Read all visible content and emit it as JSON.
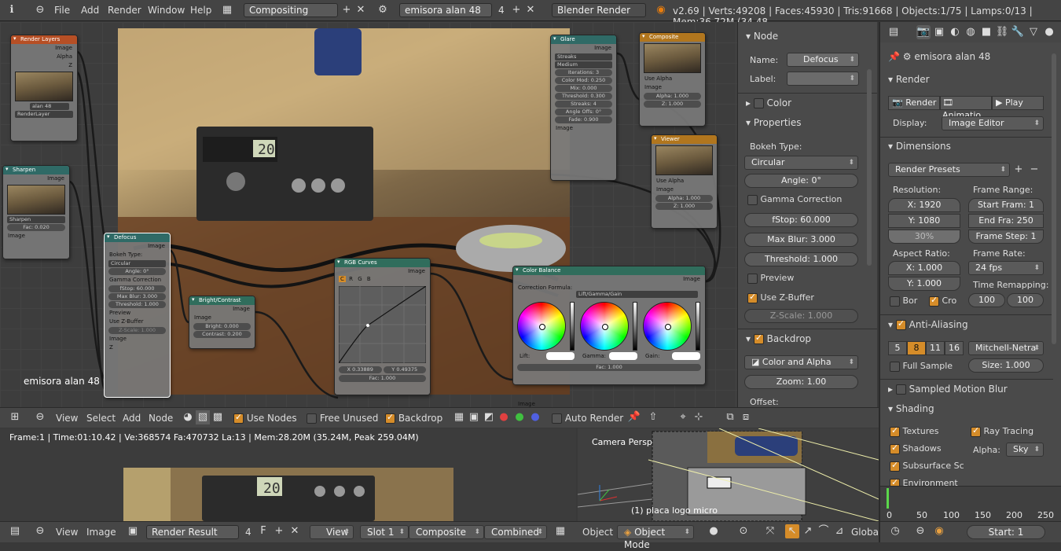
{
  "topbar": {
    "menus": [
      "File",
      "Add",
      "Render",
      "Window",
      "Help"
    ],
    "screen_layout": "Compositing",
    "scene": "emisora alan 48",
    "scene_users": "4",
    "engine": "Blender Render",
    "stats": "v2.69 | Verts:49208 | Faces:45930 | Tris:91668 | Objects:1/75 | Lamps:0/13 | Mem:36.72M (34.48"
  },
  "nodes": {
    "render_layers": {
      "title": "Render Layers",
      "out_image": "Image",
      "out_alpha": "Alpha",
      "out_z": "Z",
      "scene": "alan 48",
      "layer": "RenderLayer"
    },
    "sharpen": {
      "title": "Sharpen",
      "out_image": "Image",
      "mode": "Sharpen",
      "fac": "Fac: 0.020",
      "in_image": "Image"
    },
    "defocus": {
      "title": "Defocus",
      "out_image": "Image",
      "bokeh_label": "Bokeh Type:",
      "bokeh": "Circular",
      "angle": "Angle: 0°",
      "gamma": "Gamma Correction",
      "fstop": "fStop: 60.000",
      "maxblur": "Max Blur: 3.000",
      "threshold": "Threshold: 1.000",
      "preview": "Preview",
      "zbuffer": "Use Z-Buffer",
      "zscale": "Z-Scale: 1.000",
      "in_image": "Image",
      "in_z": "Z"
    },
    "bright": {
      "title": "Bright/Contrast",
      "out_image": "Image",
      "in_image": "Image",
      "bright": "Bright: 0.000",
      "contrast": "Contrast: 0.200"
    },
    "rgb": {
      "title": "RGB Curves",
      "out_image": "Image",
      "channels": [
        "C",
        "R",
        "G",
        "B"
      ],
      "x": "X 0.33889",
      "y": "Y 0.49375",
      "fac": "Fac: 1.000"
    },
    "colorbal": {
      "title": "Color Balance",
      "out_image": "Image",
      "formula_label": "Correction Formula:",
      "formula": "Lift/Gamma/Gain",
      "lift": "Lift:",
      "gamma": "Gamma:",
      "gain": "Gain:",
      "fac": "Fac: 1.000",
      "in_image": "Image"
    },
    "glare": {
      "title": "Glare",
      "out_image": "Image",
      "type": "Streaks",
      "quality": "Medium",
      "iterations": "Iterations: 3",
      "colormod": "Color Mod: 0.250",
      "mix": "Mix: 0.000",
      "threshold": "Threshold: 0.300",
      "streaks": "Streaks: 4",
      "angle": "Angle Offs: 0°",
      "fade": "Fade: 0.900",
      "in_image": "Image"
    },
    "composite": {
      "title": "Composite",
      "use_alpha": "Use Alpha",
      "in_image": "Image",
      "alpha": "Alpha: 1.000",
      "z": "Z: 1.000"
    },
    "viewer": {
      "title": "Viewer",
      "use_alpha": "Use Alpha",
      "in_image": "Image",
      "alpha": "Alpha: 1.000",
      "z": "Z: 1.000"
    }
  },
  "editor_label": "emisora alan 48",
  "node_header": {
    "menus": [
      "View",
      "Select",
      "Add",
      "Node"
    ],
    "use_nodes": "Use Nodes",
    "free_unused": "Free Unused",
    "backdrop": "Backdrop",
    "auto_render": "Auto Render"
  },
  "node_panel": {
    "node_title": "Node",
    "name_label": "Name:",
    "name_value": "Defocus",
    "label_label": "Label:",
    "color": "Color",
    "properties": "Properties",
    "bokeh_label": "Bokeh Type:",
    "bokeh": "Circular",
    "angle": "Angle: 0°",
    "gamma": "Gamma Correction",
    "fstop": "fStop: 60.000",
    "maxblur": "Max Blur: 3.000",
    "threshold": "Threshold: 1.000",
    "preview": "Preview",
    "zbuffer": "Use Z-Buffer",
    "zscale": "Z-Scale: 1.000",
    "backdrop": "Backdrop",
    "channels": "Color and Alpha",
    "zoom": "Zoom: 1.00",
    "offset": "Offset:"
  },
  "props": {
    "scene_name": "emisora alan 48",
    "render": "Render",
    "render_btn": "Render",
    "anim_btn": "Animatio",
    "play_btn": "Play",
    "display_label": "Display:",
    "display": "Image Editor",
    "dimensions": "Dimensions",
    "presets": "Render Presets",
    "resolution": "Resolution:",
    "res_x": "X: 1920",
    "res_y": "Y: 1080",
    "res_pct": "30%",
    "frame_range": "Frame Range:",
    "start": "Start Fram: 1",
    "end": "End Fra: 250",
    "step": "Frame Step: 1",
    "aspect": "Aspect Ratio:",
    "asp_x": "X: 1.000",
    "asp_y": "Y: 1.000",
    "frame_rate": "Frame Rate:",
    "fps": "24 fps",
    "remap": "Time Remapping:",
    "remap_old": "100",
    "remap_new": "100",
    "bor": "Bor",
    "cro": "Cro",
    "aa": "Anti-Aliasing",
    "aa_opts": [
      "5",
      "8",
      "11",
      "16"
    ],
    "aa_filter": "Mitchell-Netra",
    "full_sample": "Full Sample",
    "size": "Size: 1.000",
    "motion_blur": "Sampled Motion Blur",
    "shading": "Shading",
    "textures": "Textures",
    "ray": "Ray Tracing",
    "shadows": "Shadows",
    "alpha_label": "Alpha:",
    "alpha": "Sky",
    "sss": "Subsurface Sc",
    "env": "Environment"
  },
  "image_editor": {
    "info": "Frame:1 | Time:01:10.42 | Ve:368574 Fa:470732 La:13 | Mem:28.20M (35.24M, Peak 259.04M)",
    "menus": [
      "View",
      "Image"
    ],
    "image": "Render Result",
    "users": "4",
    "f": "F",
    "view": "View",
    "slot": "Slot 1",
    "pass": "Composite",
    "layer": "Combined"
  },
  "viewport": {
    "label": "Camera Persp",
    "object": "(1) placa logo micro",
    "menus": [
      "Object"
    ],
    "mode": "Object Mode",
    "orient": "Global"
  },
  "timeline": {
    "ticks": [
      "0",
      "50",
      "100",
      "150",
      "200",
      "250"
    ],
    "start": "Start: 1"
  }
}
